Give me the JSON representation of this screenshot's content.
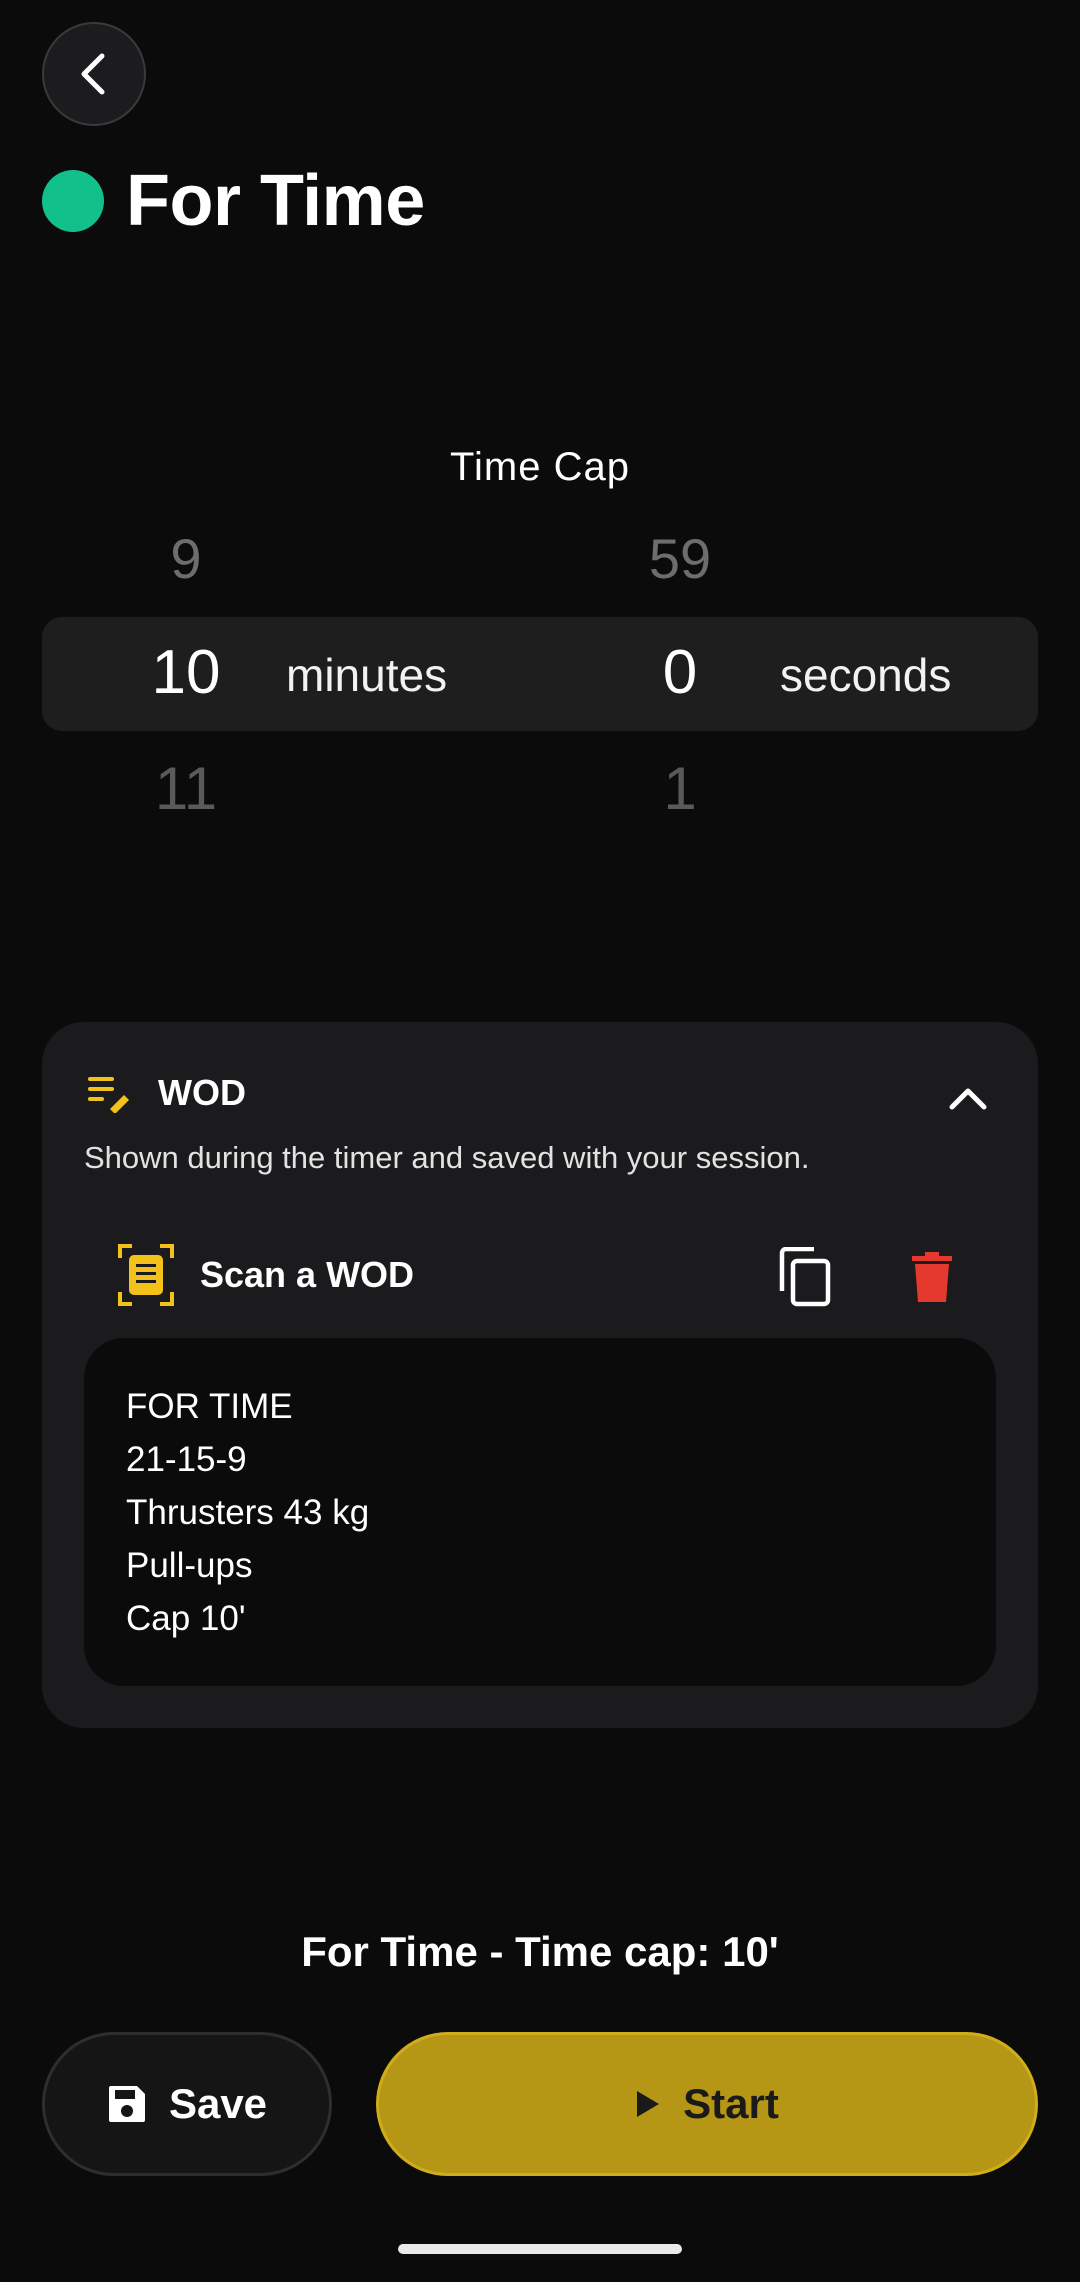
{
  "header": {
    "title": "For Time",
    "status_color": "#12c08b",
    "back_icon": "chevron-left-icon"
  },
  "picker": {
    "label": "Time Cap",
    "minutes": {
      "prev": "9",
      "selected": "10",
      "next": "11",
      "unit": "minutes"
    },
    "seconds": {
      "prev": "59",
      "selected": "0",
      "next": "1",
      "unit": "seconds"
    }
  },
  "wod": {
    "title": "WOD",
    "subtitle": "Shown during the timer and saved with your session.",
    "scan_label": "Scan a WOD",
    "icons": {
      "title": "notes-edit-icon",
      "collapse": "chevron-up-icon",
      "scan": "document-scan-icon",
      "copy": "copy-icon",
      "delete": "trash-icon"
    },
    "lines": [
      "FOR TIME",
      "21-15-9",
      "Thrusters 43 kg",
      "Pull-ups",
      "Cap 10'"
    ]
  },
  "summary": "For Time - Time cap: 10'",
  "actions": {
    "save_label": "Save",
    "start_label": "Start"
  },
  "colors": {
    "accent": "#b59615",
    "scan_icon": "#f2c21b",
    "delete": "#e5392f"
  }
}
